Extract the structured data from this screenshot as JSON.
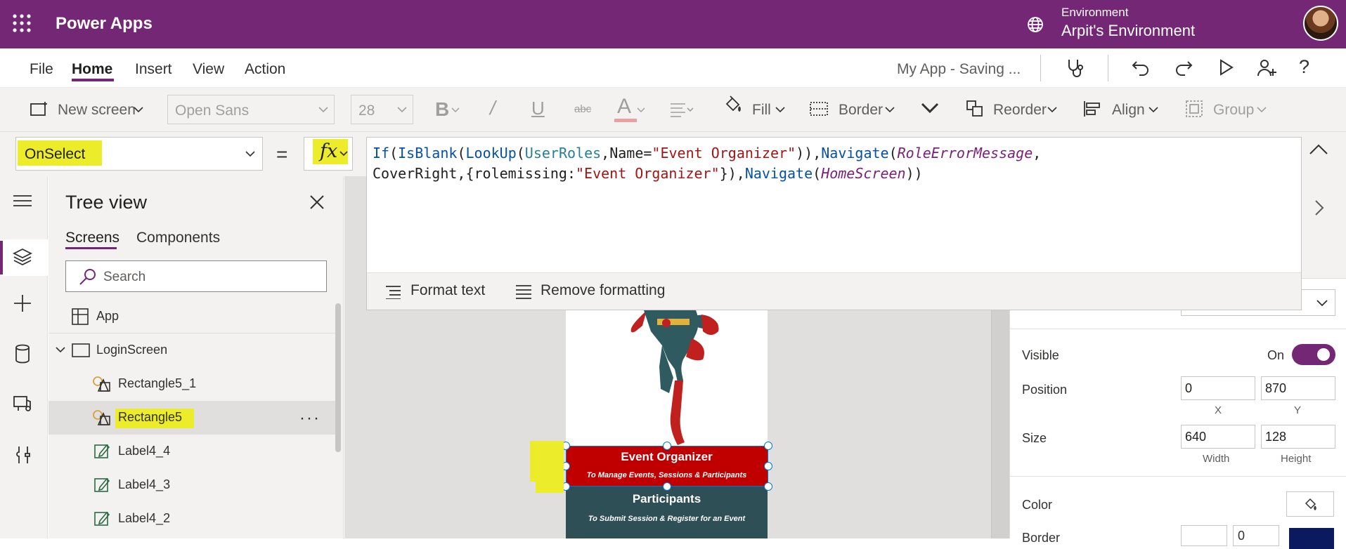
{
  "header": {
    "app_title": "Power Apps",
    "environment_label": "Environment",
    "environment_name": "Arpit's Environment",
    "brand_color": "#742774"
  },
  "menu": {
    "items": [
      "File",
      "Home",
      "Insert",
      "View",
      "Action"
    ],
    "active": "Home",
    "app_status": "My App - Saving ..."
  },
  "toolbar": {
    "new_screen": "New screen",
    "font_family": "Open Sans",
    "font_size": "28",
    "fill": "Fill",
    "border": "Border",
    "reorder": "Reorder",
    "align": "Align",
    "group": "Group"
  },
  "formula_bar": {
    "property": "OnSelect",
    "equals": "=",
    "fx": "fx",
    "line1": {
      "t1": "If",
      "t2": "(",
      "t3": "IsBlank",
      "t4": "(",
      "t5": "LookUp",
      "t6": "(",
      "t7": "UserRoles",
      "t8": ",Name=",
      "t9": "\"Event Organizer\"",
      "t10": ")),",
      "t11": "Navigate",
      "t12": "(",
      "t13": "RoleErrorMessage",
      "t14": ","
    },
    "line2": {
      "t1": "CoverRight,{rolemissing:",
      "t2": "\"Event Organizer\"",
      "t3": "}),",
      "t4": "Navigate",
      "t5": "(",
      "t6": "HomeScreen",
      "t7": "))"
    },
    "format_text": "Format text",
    "remove_formatting": "Remove formatting"
  },
  "tree_view": {
    "title": "Tree view",
    "tabs": [
      "Screens",
      "Components"
    ],
    "search_placeholder": "Search",
    "items": [
      {
        "label": "App"
      },
      {
        "label": "LoginScreen"
      },
      {
        "label": "Rectangle5_1"
      },
      {
        "label": "Rectangle5"
      },
      {
        "label": "Label4_4"
      },
      {
        "label": "Label4_3"
      },
      {
        "label": "Label4_2"
      }
    ],
    "more": "···"
  },
  "canvas": {
    "event_title": "Event Organizer",
    "event_subtitle": "To Manage Events, Sessions & Participants",
    "participants_title": "Participants",
    "participants_subtitle": "To Submit Session & Register for an Event",
    "event_color": "#c00000",
    "participants_color": "#2f4f56"
  },
  "properties": {
    "visible_label": "Visible",
    "visible_value": "On",
    "position_label": "Position",
    "position_x": "0",
    "position_y": "870",
    "x_caption": "X",
    "y_caption": "Y",
    "size_label": "Size",
    "width": "640",
    "height": "128",
    "width_caption": "Width",
    "height_caption": "Height",
    "color_label": "Color",
    "border_label": "Border",
    "border_width": "0"
  }
}
